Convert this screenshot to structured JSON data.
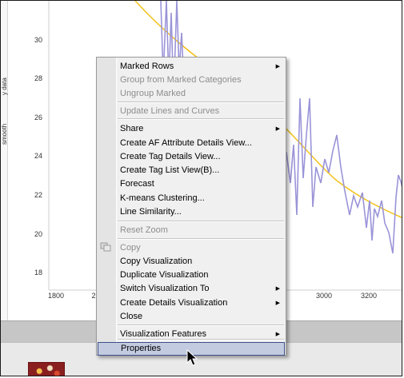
{
  "chart": {
    "y_ticks": [
      "30",
      "28",
      "26",
      "24",
      "22",
      "20",
      "18"
    ],
    "x_ticks": [
      "1800",
      "2",
      "3000",
      "3200"
    ],
    "legend_labels": [
      "y data",
      "smooth"
    ],
    "colors": {
      "series": "#9a94d8",
      "curve": "#f2c21b"
    }
  },
  "menu": {
    "items": [
      {
        "label": "Marked Rows",
        "enabled": true,
        "submenu": true
      },
      {
        "label": "Group from Marked Categories",
        "enabled": false,
        "submenu": false
      },
      {
        "label": "Ungroup Marked",
        "enabled": false,
        "submenu": false
      },
      {
        "label": "Update Lines and Curves",
        "enabled": false,
        "submenu": false
      },
      {
        "label": "Share",
        "enabled": true,
        "submenu": true
      },
      {
        "label": "Create AF Attribute Details View...",
        "enabled": true,
        "submenu": false
      },
      {
        "label": "Create Tag Details View...",
        "enabled": true,
        "submenu": false
      },
      {
        "label": "Create Tag List View(B)...",
        "enabled": true,
        "submenu": false
      },
      {
        "label": "Forecast",
        "enabled": true,
        "submenu": false
      },
      {
        "label": "K-means Clustering...",
        "enabled": true,
        "submenu": false
      },
      {
        "label": "Line Similarity...",
        "enabled": true,
        "submenu": false
      },
      {
        "label": "Reset Zoom",
        "enabled": false,
        "submenu": false
      },
      {
        "label": "Copy",
        "enabled": false,
        "submenu": false,
        "icon": "copy-icon"
      },
      {
        "label": "Copy Visualization",
        "enabled": true,
        "submenu": false
      },
      {
        "label": "Duplicate Visualization",
        "enabled": true,
        "submenu": false
      },
      {
        "label": "Switch Visualization To",
        "enabled": true,
        "submenu": true
      },
      {
        "label": "Create Details Visualization",
        "enabled": true,
        "submenu": true
      },
      {
        "label": "Close",
        "enabled": true,
        "submenu": false
      },
      {
        "label": "Visualization Features",
        "enabled": true,
        "submenu": true
      },
      {
        "label": "Properties",
        "enabled": true,
        "submenu": false,
        "selected": true
      }
    ]
  }
}
